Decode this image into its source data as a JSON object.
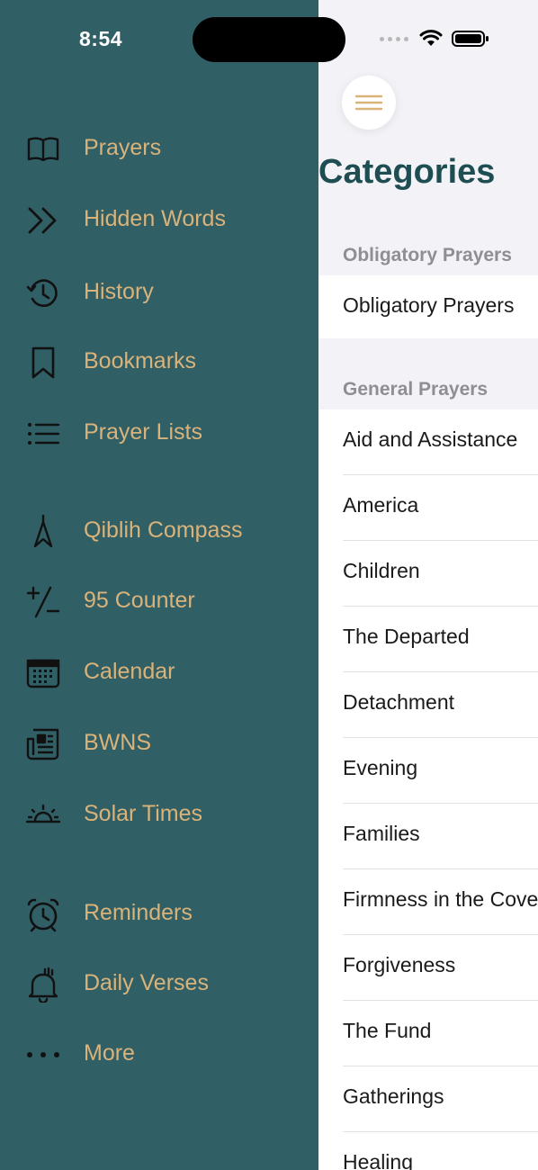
{
  "status_bar": {
    "time": "8:54"
  },
  "drawer": {
    "items": [
      {
        "label": "Prayers",
        "icon": "book-icon"
      },
      {
        "label": "Hidden Words",
        "icon": "double-chevron-icon"
      },
      {
        "label": "History",
        "icon": "history-icon"
      },
      {
        "label": "Bookmarks",
        "icon": "bookmark-icon"
      },
      {
        "label": "Prayer Lists",
        "icon": "list-icon"
      },
      {
        "label": "Qiblih Compass",
        "icon": "compass-icon"
      },
      {
        "label": "95 Counter",
        "icon": "plus-minus-icon"
      },
      {
        "label": "Calendar",
        "icon": "calendar-icon"
      },
      {
        "label": "BWNS",
        "icon": "newspaper-icon"
      },
      {
        "label": "Solar Times",
        "icon": "sunrise-icon"
      },
      {
        "label": "Reminders",
        "icon": "alarm-icon"
      },
      {
        "label": "Daily Verses",
        "icon": "bell-icon"
      },
      {
        "label": "More",
        "icon": "more-icon"
      }
    ]
  },
  "main": {
    "title": "Categories",
    "sections": [
      {
        "header": "Obligatory Prayers",
        "rows": [
          "Obligatory Prayers"
        ]
      },
      {
        "header": "General Prayers",
        "rows": [
          "Aid and Assistance",
          "America",
          "Children",
          "The Departed",
          "Detachment",
          "Evening",
          "Families",
          "Firmness in the Covenant",
          "Forgiveness",
          "The Fund",
          "Gatherings",
          "Healing"
        ]
      }
    ]
  },
  "colors": {
    "drawer_bg": "#315F66",
    "drawer_text": "#D9B37A",
    "title": "#1E4D52",
    "hamburger": "#D9B37A"
  }
}
